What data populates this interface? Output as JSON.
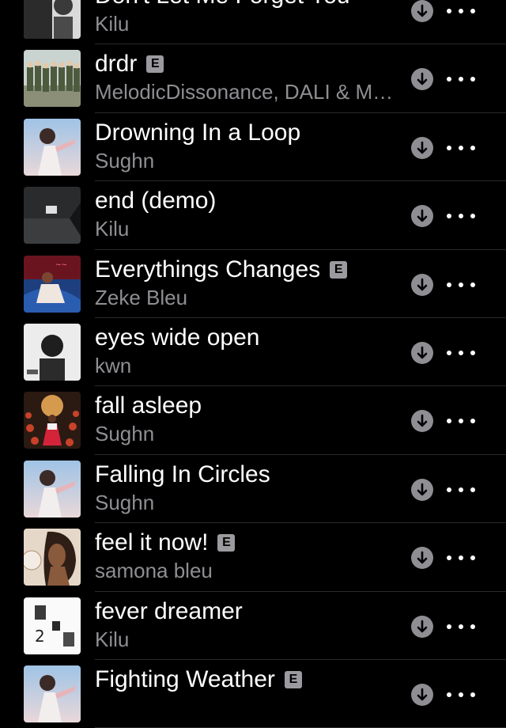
{
  "tracks": [
    {
      "title": "Don't Let Me Forget You",
      "artist": "Kilu",
      "explicit": false,
      "art": "bw-portrait"
    },
    {
      "title": "drdr",
      "artist": "MelodicDissonance, DALI & Ma...",
      "explicit": true,
      "explicit_label": "E",
      "art": "group-photo"
    },
    {
      "title": "Drowning In a Loop",
      "artist": "Sughn",
      "explicit": false,
      "art": "sky-figure"
    },
    {
      "title": "end (demo)",
      "artist": "Kilu",
      "explicit": false,
      "art": "dark-room"
    },
    {
      "title": "Everythings Changes",
      "artist": "Zeke Bleu",
      "explicit": true,
      "explicit_label": "E",
      "art": "red-figure"
    },
    {
      "title": "eyes wide open",
      "artist": "kwn",
      "explicit": false,
      "art": "bw-portrait-2"
    },
    {
      "title": "fall asleep",
      "artist": "Sughn",
      "explicit": false,
      "art": "flowers-figure"
    },
    {
      "title": "Falling In Circles",
      "artist": "Sughn",
      "explicit": false,
      "art": "sky-figure"
    },
    {
      "title": "feel it now!",
      "artist": "samona bleu",
      "explicit": true,
      "explicit_label": "E",
      "art": "woman-portrait"
    },
    {
      "title": "fever dreamer",
      "artist": "Kilu",
      "explicit": false,
      "art": "white-collage"
    },
    {
      "title": "Fighting Weather",
      "artist": "",
      "explicit": true,
      "explicit_label": "E",
      "art": "sky-figure"
    }
  ],
  "icons": {
    "download": "download-circle-icon",
    "more": "ellipsis-icon"
  },
  "colors": {
    "background": "#000000",
    "primary_text": "#ffffff",
    "secondary_text": "#8e8e93",
    "explicit_badge": "#9a9a9f",
    "divider": "#2a2a2c"
  }
}
